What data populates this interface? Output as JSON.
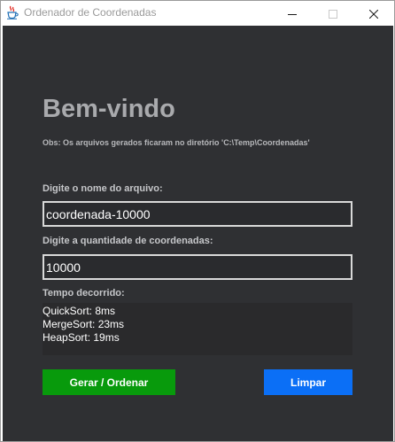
{
  "window": {
    "title": "Ordenador de Coordenadas"
  },
  "main": {
    "heading": "Bem-vindo",
    "note": "Obs: Os arquivos gerados ficaram no diretório 'C:\\Temp\\Coordenadas'",
    "file_label": "Digite o nome do arquivo:",
    "file_value": "coordenada-10000",
    "quantity_label": "Digite a quantidade de coordenadas:",
    "quantity_value": "10000",
    "elapsed_label": "Tempo decorrido:",
    "results": [
      "QuickSort: 8ms",
      "MergeSort: 23ms",
      "HeapSort: 19ms"
    ]
  },
  "buttons": {
    "generate_label": "Gerar / Ordenar",
    "clear_label": "Limpar"
  },
  "colors": {
    "background": "#2f3033",
    "generate": "#089a0c",
    "clear": "#0b6ff6"
  },
  "icons": {
    "app": "java-cup-icon",
    "minimize": "minimize-icon",
    "maximize": "maximize-icon",
    "close": "close-icon"
  }
}
